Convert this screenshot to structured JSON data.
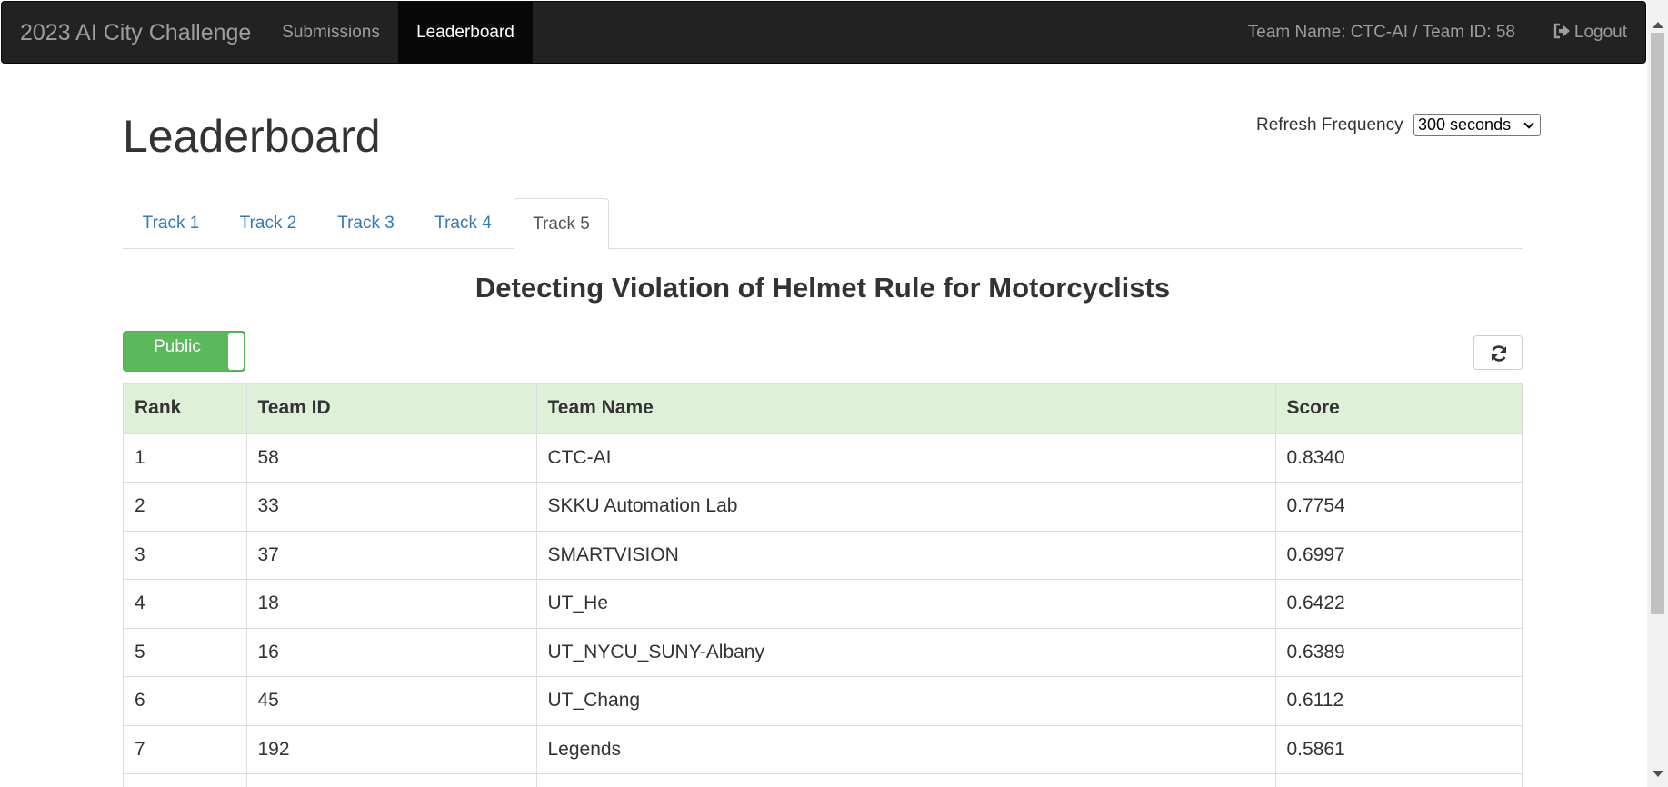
{
  "navbar": {
    "brand": "2023 AI City Challenge",
    "links": [
      "Submissions",
      "Leaderboard"
    ],
    "team_info": "Team Name: CTC-AI / Team ID: 58",
    "logout_label": "Logout"
  },
  "page": {
    "title": "Leaderboard",
    "refresh_label": "Refresh Frequency",
    "refresh_value": "300 seconds"
  },
  "tabs": [
    "Track 1",
    "Track 2",
    "Track 3",
    "Track 4",
    "Track 5"
  ],
  "active_tab": "Track 5",
  "task_title": "Detecting Violation of Helmet Rule for Motorcyclists",
  "toggle": {
    "label": "Public",
    "color": "#5cb85c"
  },
  "table": {
    "headers": [
      "Rank",
      "Team ID",
      "Team Name",
      "Score"
    ],
    "rows": [
      [
        "1",
        "58",
        "CTC-AI",
        "0.8340"
      ],
      [
        "2",
        "33",
        "SKKU Automation Lab",
        "0.7754"
      ],
      [
        "3",
        "37",
        "SMARTVISION",
        "0.6997"
      ],
      [
        "4",
        "18",
        "UT_He",
        "0.6422"
      ],
      [
        "5",
        "16",
        "UT_NYCU_SUNY-Albany",
        "0.6389"
      ],
      [
        "6",
        "45",
        "UT_Chang",
        "0.6112"
      ],
      [
        "7",
        "192",
        "Legends",
        "0.5861"
      ],
      [
        "",
        "",
        "",
        ""
      ]
    ]
  },
  "icons": {
    "logout": "logout-icon",
    "refresh": "refresh-icon"
  },
  "colors": {
    "navbar_bg": "#222222",
    "link_blue": "#337ab7",
    "header_row_bg": "#dff0d8"
  }
}
